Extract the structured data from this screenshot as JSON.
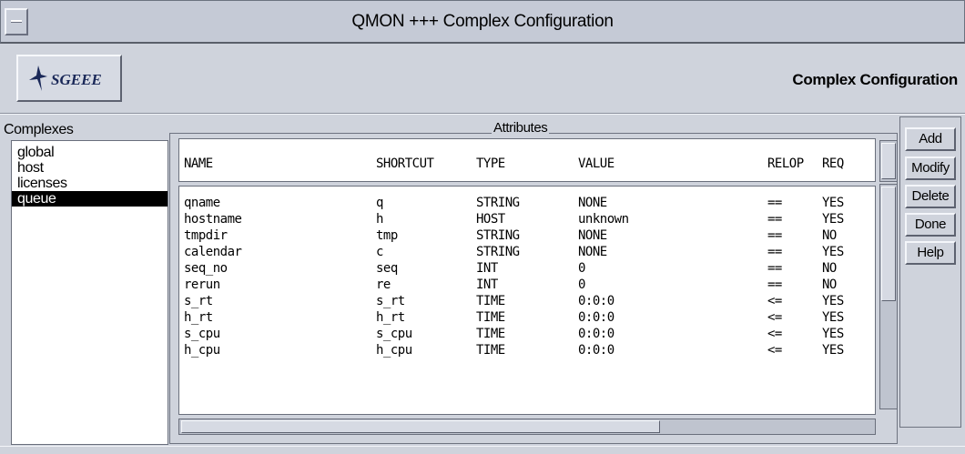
{
  "window": {
    "title": "QMON +++ Complex Configuration"
  },
  "header": {
    "logo_text": "SGEEE",
    "title": "Complex Configuration"
  },
  "complexes": {
    "label": "Complexes",
    "items": [
      "global",
      "host",
      "licenses",
      "queue"
    ],
    "selected": "queue"
  },
  "attributes": {
    "label": "Attributes",
    "columns": [
      "NAME",
      "SHORTCUT",
      "TYPE",
      "VALUE",
      "RELOP",
      "REQ"
    ],
    "rows": [
      [
        "qname",
        "q",
        "STRING",
        "NONE",
        "==",
        "YES"
      ],
      [
        "hostname",
        "h",
        "HOST",
        "unknown",
        "==",
        "YES"
      ],
      [
        "tmpdir",
        "tmp",
        "STRING",
        "NONE",
        "==",
        "NO"
      ],
      [
        "calendar",
        "c",
        "STRING",
        "NONE",
        "==",
        "YES"
      ],
      [
        "seq_no",
        "seq",
        "INT",
        "0",
        "==",
        "NO"
      ],
      [
        "rerun",
        "re",
        "INT",
        "0",
        "==",
        "NO"
      ],
      [
        "s_rt",
        "s_rt",
        "TIME",
        "0:0:0",
        "<=",
        "YES"
      ],
      [
        "h_rt",
        "h_rt",
        "TIME",
        "0:0:0",
        "<=",
        "YES"
      ],
      [
        "s_cpu",
        "s_cpu",
        "TIME",
        "0:0:0",
        "<=",
        "YES"
      ],
      [
        "h_cpu",
        "h_cpu",
        "TIME",
        "0:0:0",
        "<=",
        "YES"
      ]
    ]
  },
  "buttons": {
    "add": "Add",
    "modify": "Modify",
    "delete": "Delete",
    "done": "Done",
    "help": "Help"
  },
  "icons": {
    "window_menu": "window-menu-icon",
    "logo": "sgeee-bird-logo-icon"
  }
}
